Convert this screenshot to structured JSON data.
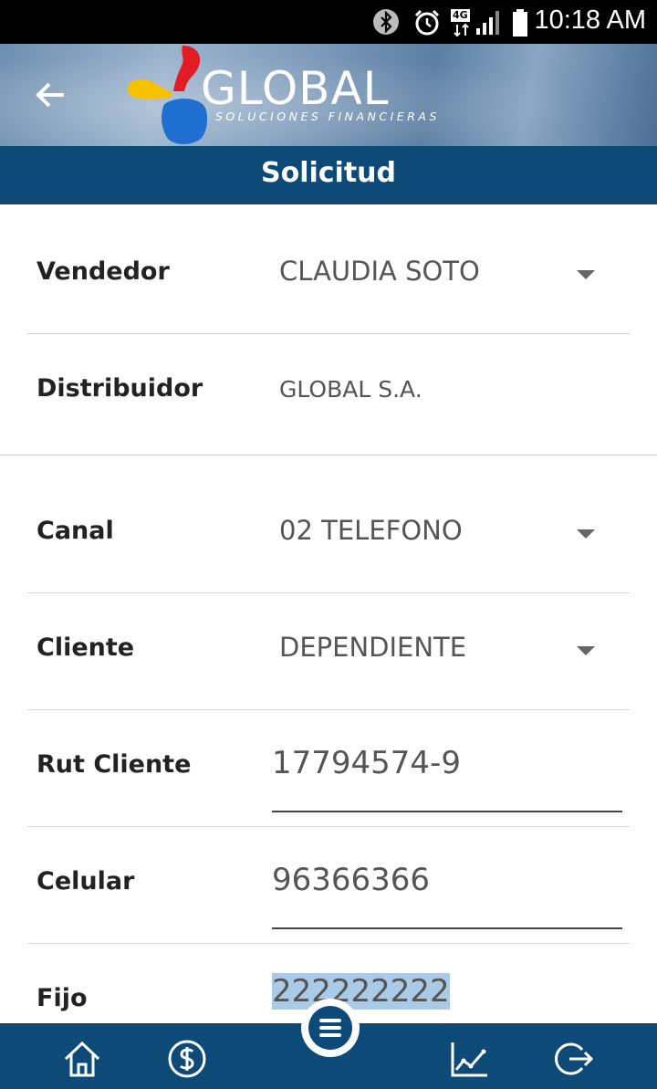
{
  "status_bar": {
    "time": "10:18 AM",
    "network": "4G"
  },
  "header": {
    "logo_text": "GLOBAL",
    "logo_subtitle": "SOLUCIONES FINANCIERAS",
    "title": "Solicitud"
  },
  "form": {
    "vendedor": {
      "label": "Vendedor",
      "value": "CLAUDIA SOTO"
    },
    "distribuidor": {
      "label": "Distribuidor",
      "value": "GLOBAL S.A."
    },
    "canal": {
      "label": "Canal",
      "value": "02 TELEFONO"
    },
    "cliente": {
      "label": "Cliente",
      "value": "DEPENDIENTE"
    },
    "rut_cliente": {
      "label": "Rut Cliente",
      "value": "17794574-9"
    },
    "celular": {
      "label": "Celular",
      "value": "96366366"
    },
    "fijo": {
      "label": "Fijo",
      "value": "222222222"
    }
  },
  "bottom_nav": [
    "home-icon",
    "dollar-icon",
    "menu-icon",
    "chart-icon",
    "logout-icon"
  ],
  "colors": {
    "primary": "#0e4a78",
    "selection": "#a9cbe8"
  }
}
